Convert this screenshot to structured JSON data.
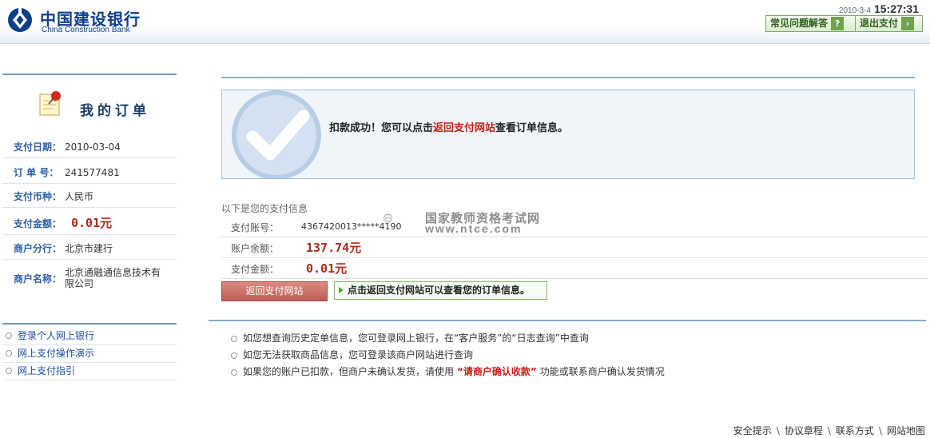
{
  "header": {
    "logo_cn": "中国建设银行",
    "logo_en": "China Construction Bank",
    "date": "2010-3-4",
    "time": "15:27:31",
    "faq_label": "常见问题解答",
    "exit_label": "退出支付"
  },
  "sidebar": {
    "title": "我的订单",
    "rows": [
      {
        "label": "支付日期：",
        "value": "2010-03-04"
      },
      {
        "label": "订 单 号：",
        "value": "241577481"
      },
      {
        "label": "支付币种：",
        "value": "人民币"
      },
      {
        "label": "支付金额：",
        "value": "0.01元"
      },
      {
        "label": "商户分行：",
        "value": "北京市建行"
      },
      {
        "label": "商户名称：",
        "value": "北京通融通信息技术有限公司"
      }
    ],
    "links": [
      "登录个人网上银行",
      "网上支付操作演示",
      "网上支付指引"
    ]
  },
  "success": {
    "prefix": "扣款成功！您可以点击",
    "link": "返回支付网站",
    "suffix": "查看订单信息。"
  },
  "payment_info": {
    "title": "以下是您的支付信息",
    "rows": [
      {
        "label": "支付账号：",
        "value": "4367420013*****4190"
      },
      {
        "label": "账户余额：",
        "value": "137.74元"
      },
      {
        "label": "支付金额：",
        "value": "0.01元"
      }
    ],
    "back_button": "返回支付网站",
    "back_tip": "点击返回支付网站可以查看您的订单信息。"
  },
  "notes": [
    {
      "before": "如您想查询历史定单信息，您可登录网上银行，在“客户服务”的“日志查询”中查询",
      "hl": "",
      "after": ""
    },
    {
      "before": "如您无法获取商品信息，您可登录该商户网站进行查询",
      "hl": "",
      "after": ""
    },
    {
      "before": "如果您的账户已扣款，但商户未确认发货，请使用",
      "hl": "“请商户确认收款”",
      "after": "功能或联系商户确认发货情况"
    }
  ],
  "watermark": {
    "line1": "国家教师资格考试网",
    "line2": "www.ntce.com"
  },
  "footer": [
    "安全提示",
    "协议章程",
    "联系方式",
    "网站地图"
  ],
  "colors": {
    "brand": "#0c3e8c",
    "label_blue": "#2b5fa5",
    "amount_red": "#b2291b",
    "link_red": "#c51f12",
    "rule_blue": "#6e96bf"
  }
}
